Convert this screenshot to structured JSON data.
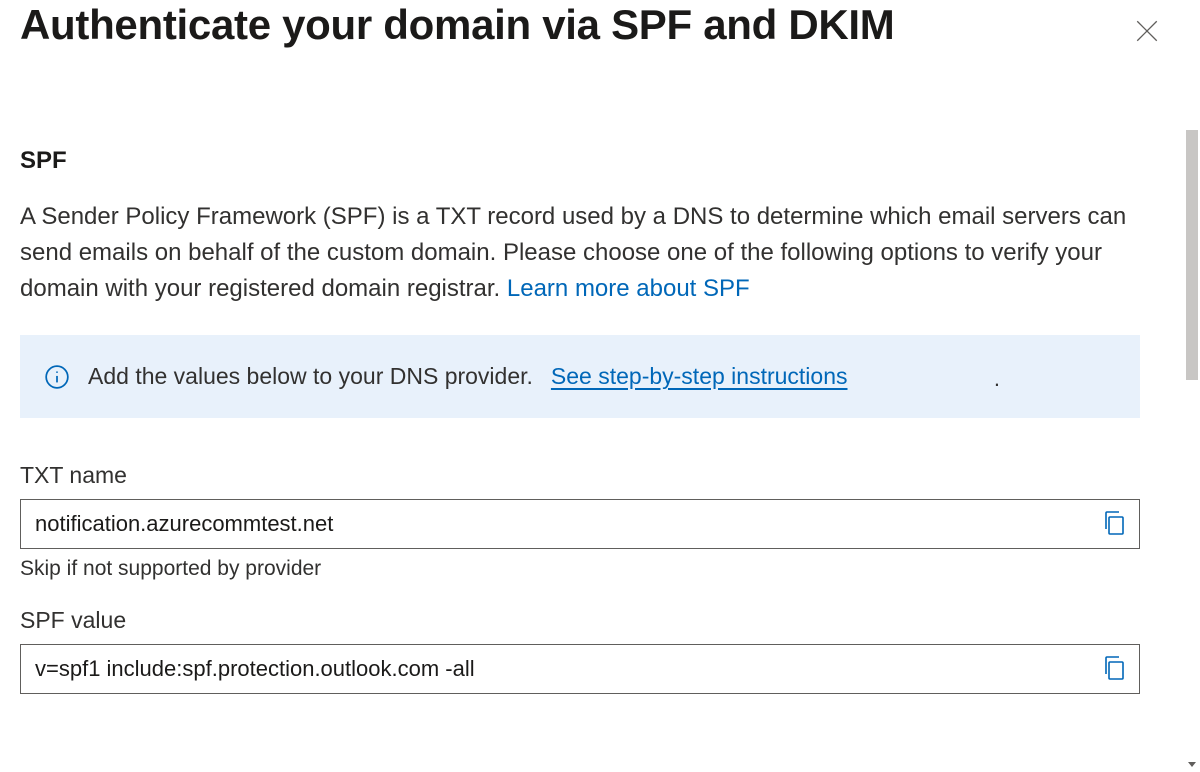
{
  "header": {
    "title": "Authenticate your domain via SPF and DKIM"
  },
  "spf": {
    "heading": "SPF",
    "description": "A Sender Policy Framework (SPF) is a TXT record used by a DNS to determine which email servers can send emails on behalf of the custom domain. Please choose one of the following options to verify your domain with your registered domain registrar. ",
    "learn_more": "Learn more about SPF",
    "banner": {
      "text": "Add the values below to your DNS provider.  ",
      "link": "See step-by-step instructions"
    },
    "txt_name": {
      "label": "TXT name",
      "value": "notification.azurecommtest.net",
      "helper": "Skip if not supported by provider"
    },
    "spf_value": {
      "label": "SPF value",
      "value": "v=spf1 include:spf.protection.outlook.com -all"
    }
  }
}
